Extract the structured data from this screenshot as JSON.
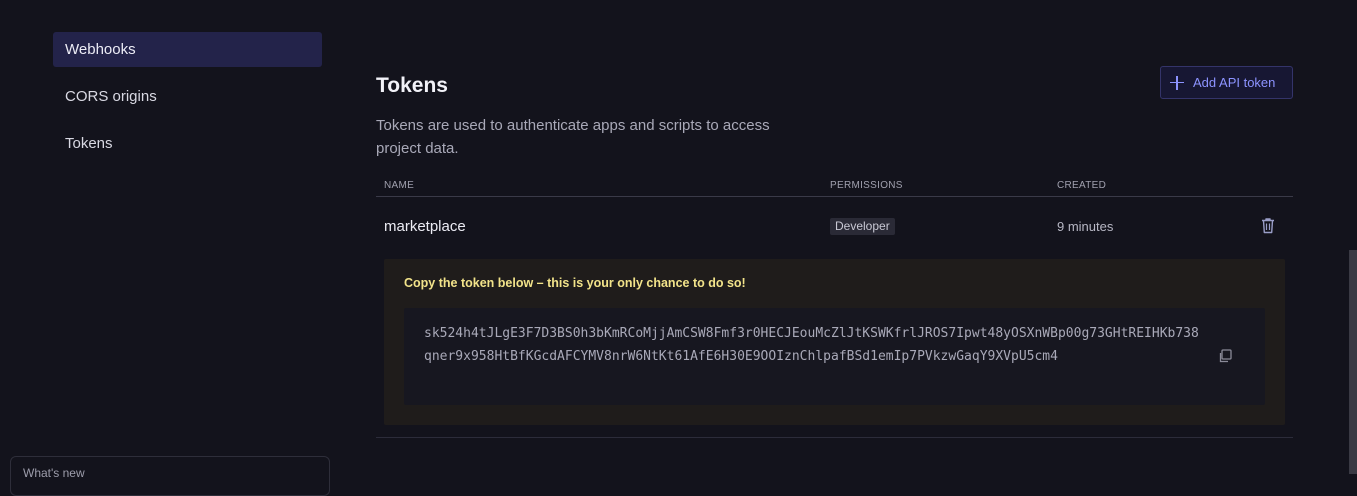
{
  "sidebar": {
    "items": [
      {
        "label": "Webhooks",
        "active": true
      },
      {
        "label": "CORS origins",
        "active": false
      },
      {
        "label": "Tokens",
        "active": false
      }
    ],
    "whats_new": "What's new"
  },
  "main": {
    "title": "Tokens",
    "description": "Tokens are used to authenticate apps and scripts to access project data.",
    "add_button": {
      "label": "Add API token",
      "icon": "plus-icon"
    },
    "table": {
      "columns": [
        "NAME",
        "PERMISSIONS",
        "CREATED"
      ],
      "rows": [
        {
          "name": "marketplace",
          "permission": "Developer",
          "created": "9 minutes",
          "action_icon": "trash-icon"
        }
      ]
    },
    "token_notice": {
      "message": "Copy the token below – this is your only chance to do so!",
      "token": "sk524h4tJLgE3F7D3BS0h3bKmRCoMjjAmCSW8Fmf3r0HECJEouMcZlJtKSWKfrlJROS7Ipwt48yOSXnWBp00g73GHtREIHKb738qner9x958HtBfKGcdAFCYMV8nrW6NtKt61AfE6H30E9OOIznChlpafBSd1emIp7PVkzwGaqY9XVpU5cm4",
      "copy_icon": "copy-icon"
    }
  },
  "colors": {
    "background": "#13131c",
    "accent": "#8c93ff",
    "active_nav": "#23234a",
    "warning": "#f2e38a"
  }
}
